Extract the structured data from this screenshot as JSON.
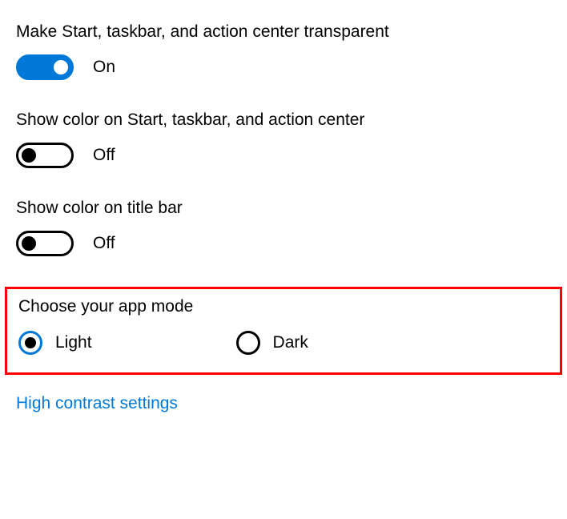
{
  "settings": {
    "transparency": {
      "label": "Make Start, taskbar, and action center transparent",
      "state": "On",
      "enabled": true
    },
    "show_color_start": {
      "label": "Show color on Start, taskbar, and action center",
      "state": "Off",
      "enabled": false
    },
    "show_color_title": {
      "label": "Show color on title bar",
      "state": "Off",
      "enabled": false
    }
  },
  "app_mode": {
    "heading": "Choose your app mode",
    "options": {
      "light": {
        "label": "Light",
        "selected": true
      },
      "dark": {
        "label": "Dark",
        "selected": false
      }
    }
  },
  "link": {
    "high_contrast": "High contrast settings"
  }
}
